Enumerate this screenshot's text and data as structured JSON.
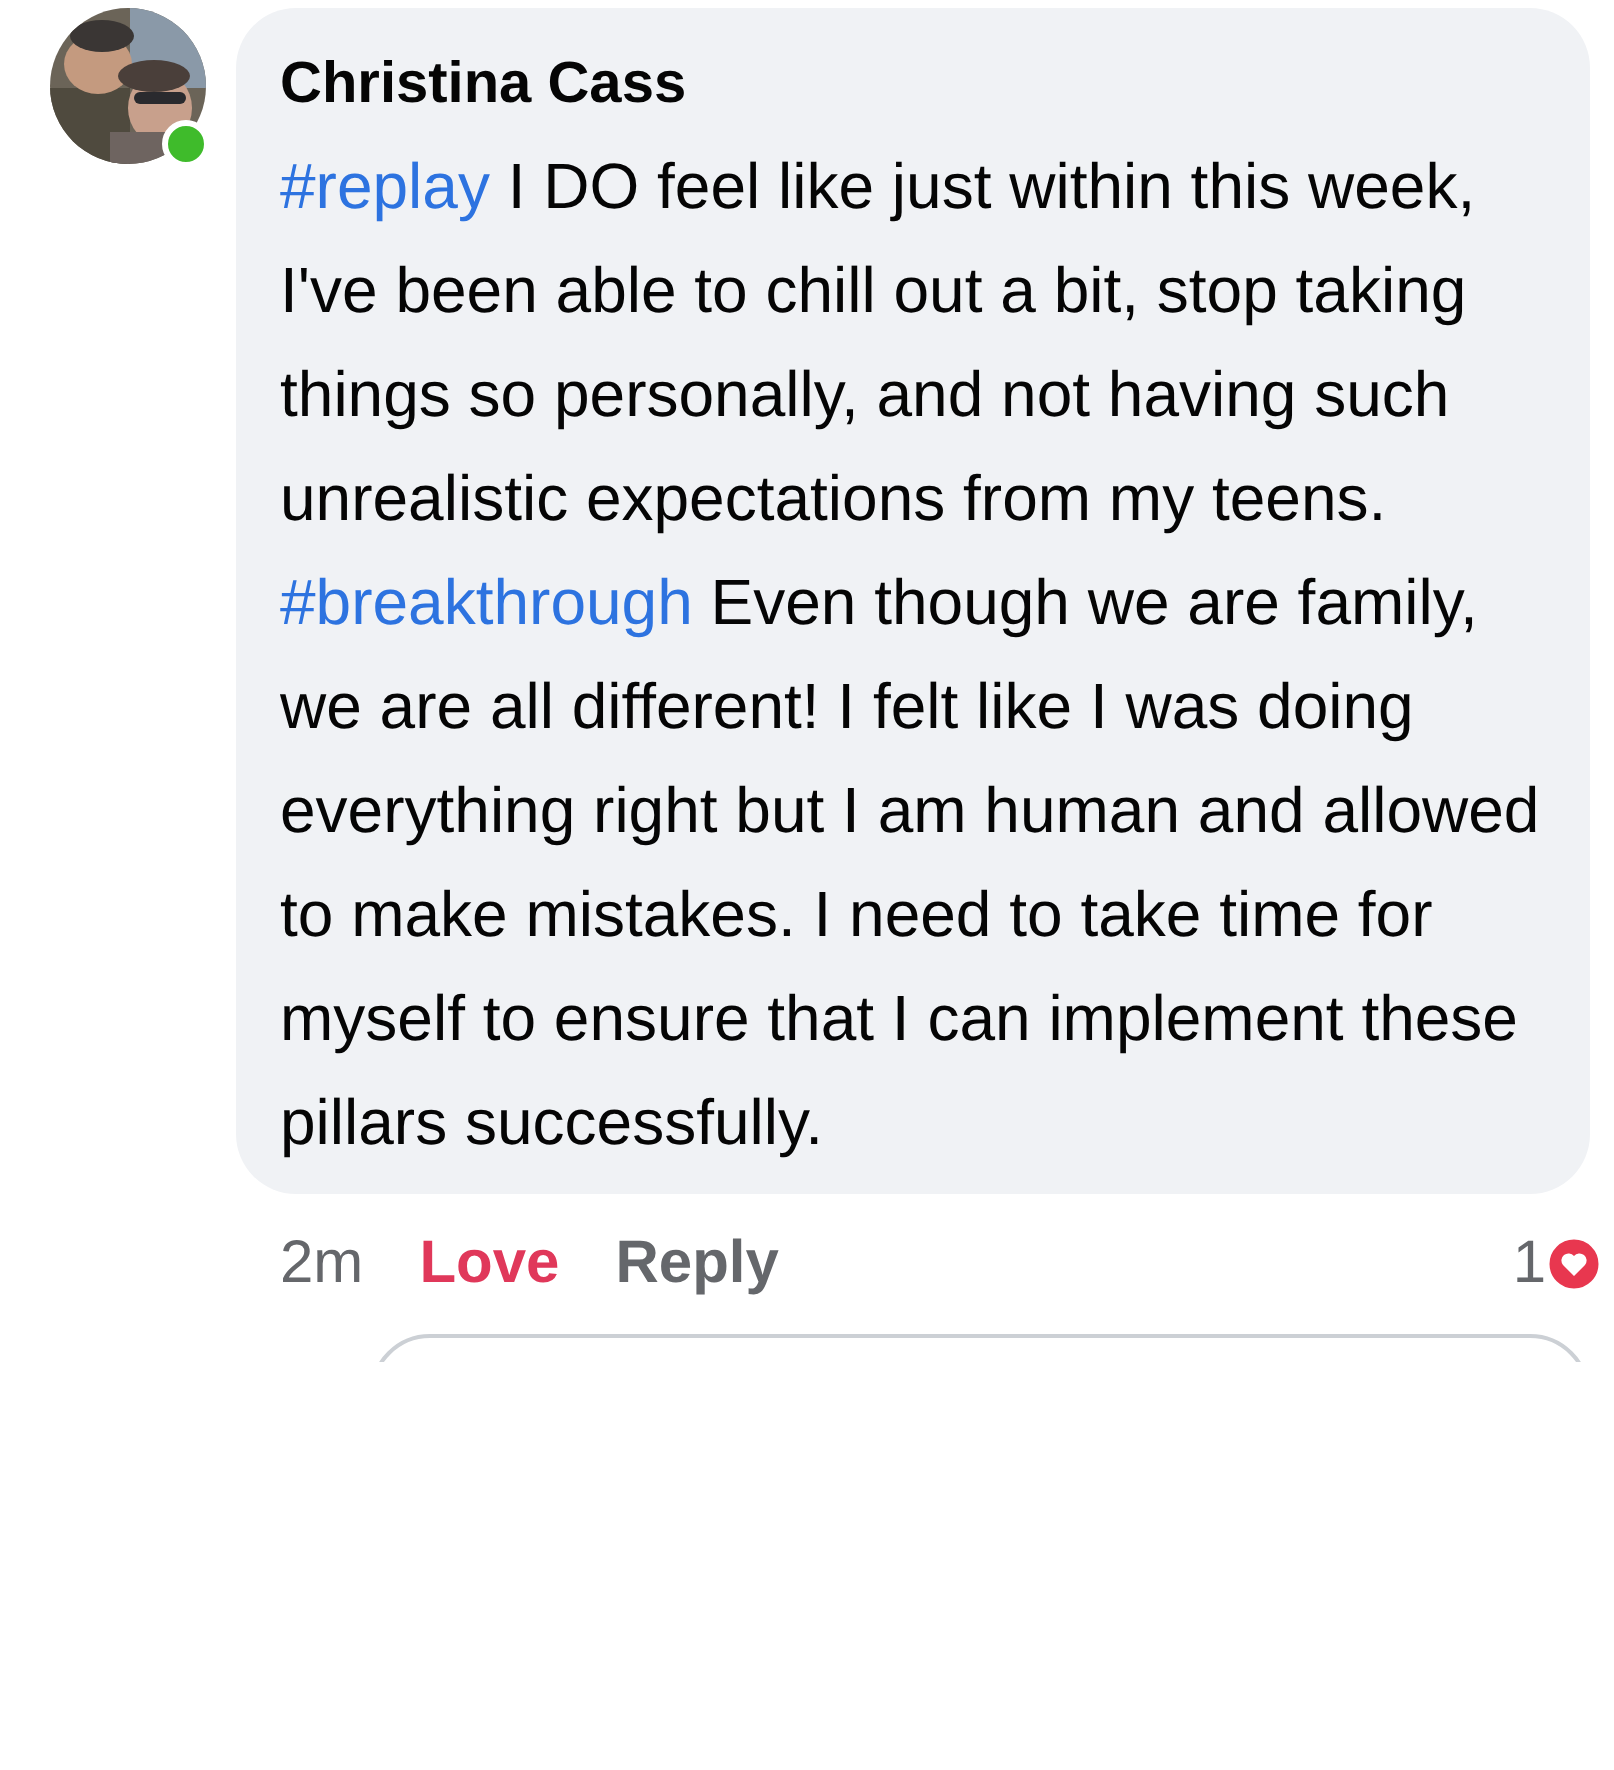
{
  "comment": {
    "author": "Christina Cass",
    "online": true,
    "paragraphs": [
      {
        "hashtag": "#replay",
        "text": "I DO feel like just within this week, I've been able to chill out a bit, stop taking things so personally, and not having such unrealistic expectations from my teens."
      },
      {
        "hashtag": "#breakthrough",
        "text": "Even though we are family, we are all different! I felt like I was doing everything right but I am human and allowed to make mistakes.  I need to take time for myself to ensure that I can implement these pillars successfully."
      }
    ]
  },
  "actions": {
    "time": "2m",
    "reaction": {
      "label": "Love",
      "active": true
    },
    "reply": "Reply",
    "reaction_count": "1"
  }
}
